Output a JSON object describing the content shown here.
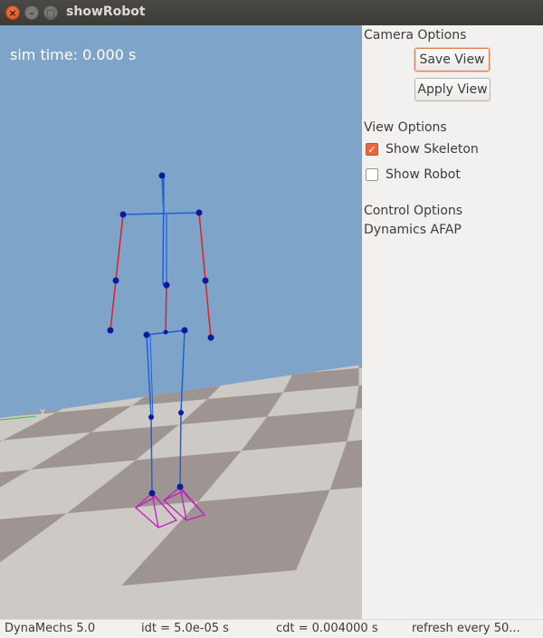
{
  "window": {
    "title": "showRobot",
    "buttons": {
      "close": "×",
      "minimize": "–",
      "maximize": "□"
    }
  },
  "viewport": {
    "sim_time": "sim time: 0.000 s",
    "axis_label": "Y"
  },
  "panel": {
    "camera_options": "Camera Options",
    "save_view": "Save View",
    "apply_view": "Apply View",
    "view_options": "View Options",
    "show_skeleton": {
      "label": "Show Skeleton",
      "checked": true
    },
    "show_robot": {
      "label": "Show Robot",
      "checked": false
    },
    "control_options": "Control Options",
    "control_mode": "Dynamics AFAP"
  },
  "statusbar": {
    "version": "DynaMechs 5.0",
    "idt": "idt = 5.0e-05 s",
    "cdt": "cdt = 0.004000 s",
    "refresh": "refresh every 50..."
  },
  "colors": {
    "sky": "#7fa4c9",
    "floor_light": "#cdc9c5",
    "floor_dark": "#9e9593",
    "skeleton_blue": "#1f5fd6",
    "skeleton_red": "#e02020",
    "joint": "#0a1aa0",
    "foot": "#c020c0",
    "accent": "#e9683f"
  }
}
